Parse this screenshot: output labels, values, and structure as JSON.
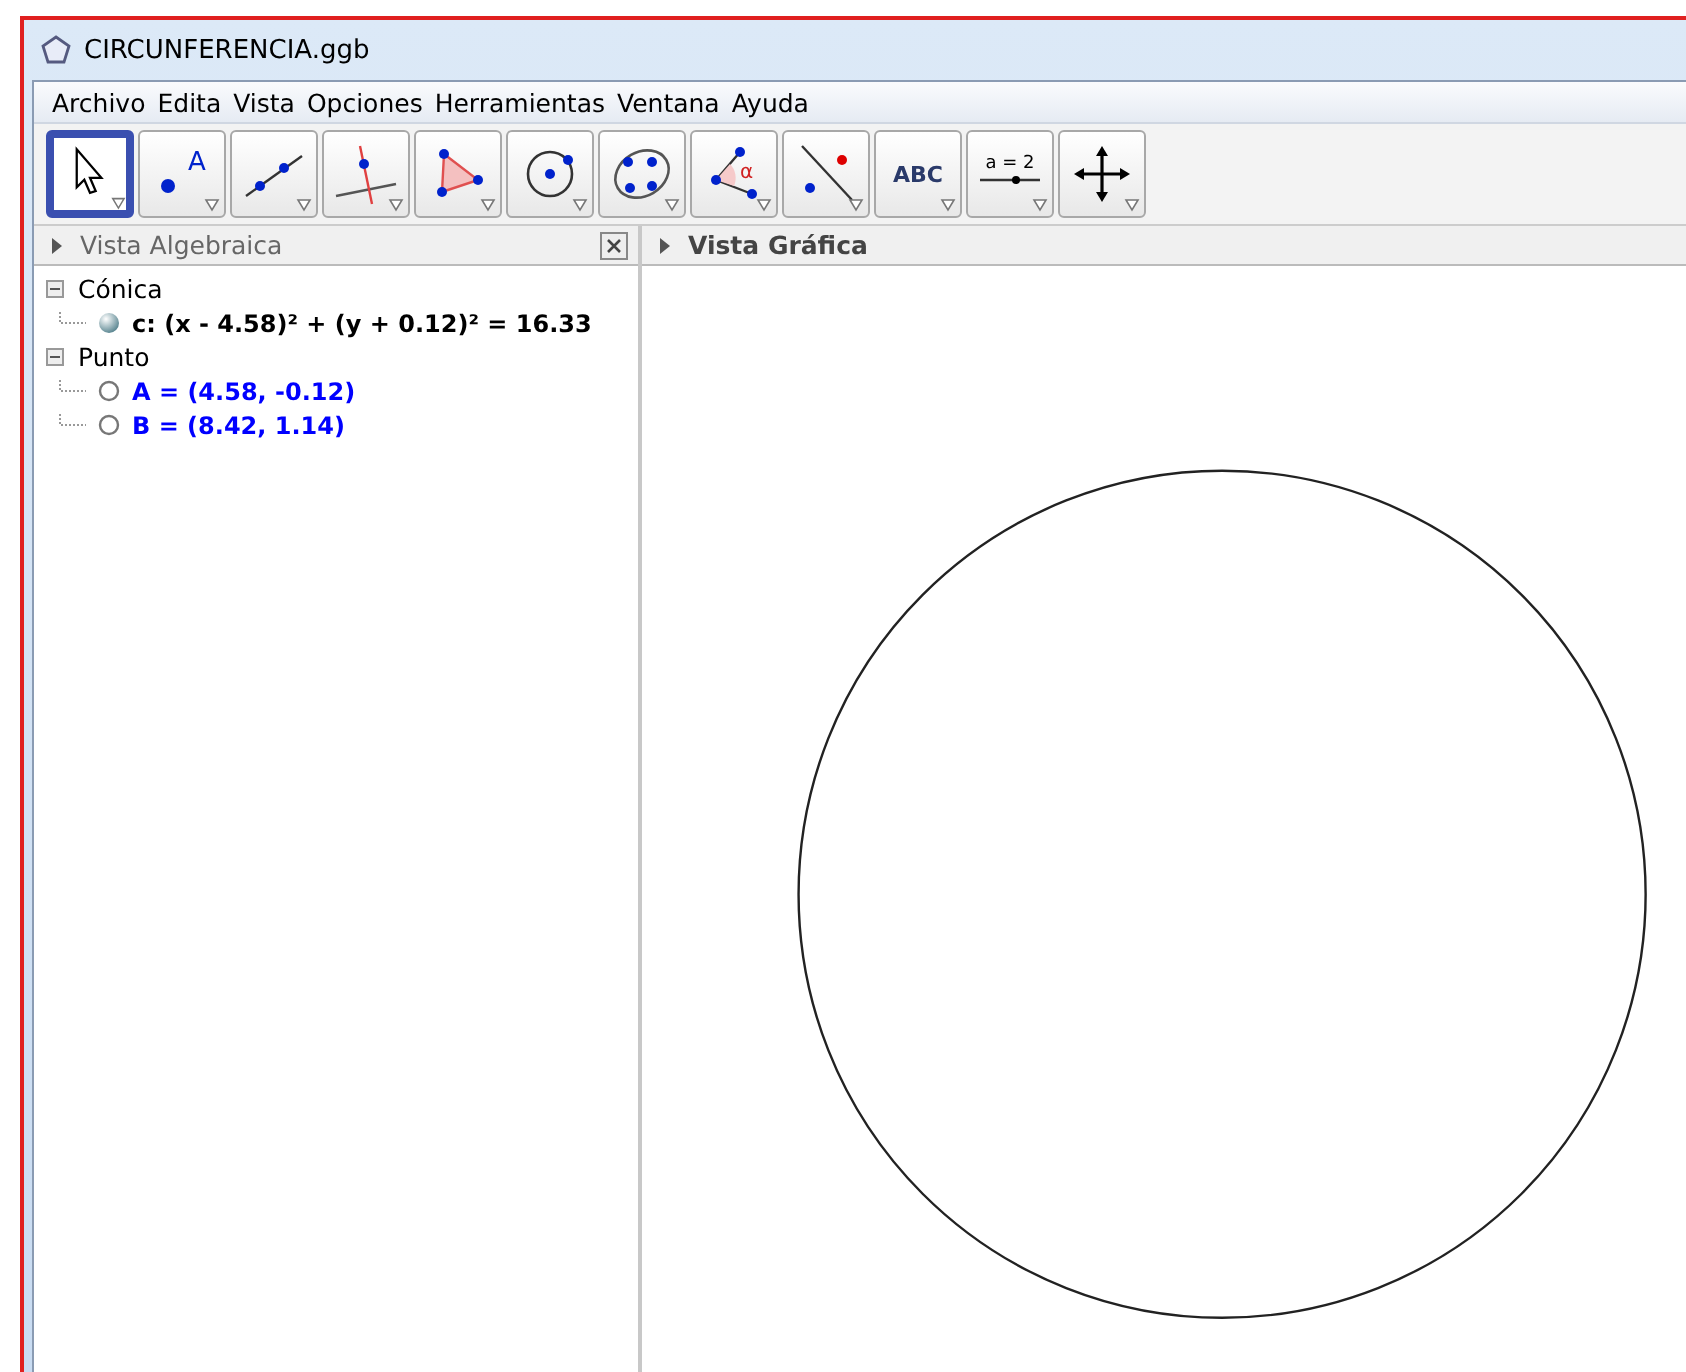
{
  "window": {
    "title": "CIRCUNFERENCIA.ggb"
  },
  "menu": [
    "Archivo",
    "Edita",
    "Vista",
    "Opciones",
    "Herramientas",
    "Ventana",
    "Ayuda"
  ],
  "tools": [
    {
      "kind": "move",
      "selected": true
    },
    {
      "kind": "point",
      "label": "A",
      "selected": false
    },
    {
      "kind": "line",
      "selected": false
    },
    {
      "kind": "perpendicular",
      "selected": false
    },
    {
      "kind": "polygon",
      "selected": false
    },
    {
      "kind": "circle",
      "selected": false
    },
    {
      "kind": "conic",
      "selected": false
    },
    {
      "kind": "angle",
      "label": "α",
      "selected": false
    },
    {
      "kind": "reflect",
      "selected": false
    },
    {
      "kind": "text",
      "label": "ABC",
      "selected": false
    },
    {
      "kind": "slider",
      "label": "a = 2",
      "selected": false
    },
    {
      "kind": "pan",
      "selected": false
    }
  ],
  "algebra_view": {
    "title": "Vista Algebraica",
    "groups": [
      {
        "label": "Cónica",
        "expanded": true,
        "children": [
          {
            "text": "c: (x - 4.58)² + (y + 0.12)² = 16.33",
            "visible": true,
            "color": "#000000"
          }
        ]
      },
      {
        "label": "Punto",
        "expanded": true,
        "children": [
          {
            "text": "A = (4.58, -0.12)",
            "visible": false,
            "color": "#0000ff"
          },
          {
            "text": "B = (8.42, 1.14)",
            "visible": false,
            "color": "#0000ff"
          }
        ]
      }
    ]
  },
  "graphics_view": {
    "title": "Vista Gráfica"
  }
}
